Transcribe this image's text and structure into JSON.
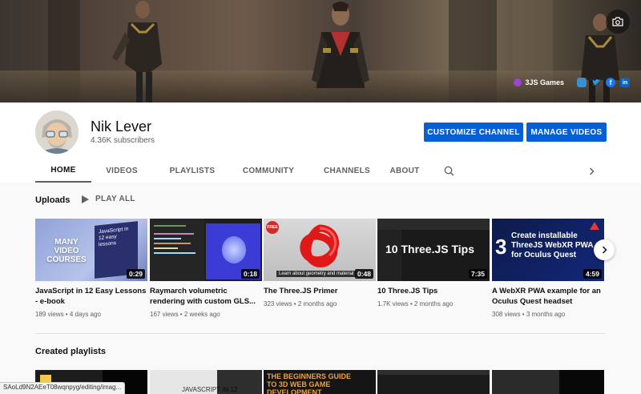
{
  "banner": {
    "link_label": "3JS Games",
    "social_icons": [
      "community-icon",
      "twitter-icon",
      "facebook-icon",
      "linkedin-icon"
    ]
  },
  "channel": {
    "name": "Nik Lever",
    "subscribers": "4.36K subscribers"
  },
  "buttons": {
    "customize": "CUSTOMIZE CHANNEL",
    "manage": "MANAGE VIDEOS"
  },
  "tabs": [
    "HOME",
    "VIDEOS",
    "PLAYLISTS",
    "COMMUNITY",
    "CHANNELS",
    "ABOUT"
  ],
  "uploads": {
    "title": "Uploads",
    "play_all": "PLAY ALL",
    "videos": [
      {
        "title": "JavaScript in 12 Easy Lessons - e-book",
        "views": "189 views",
        "age": "4 days ago",
        "duration": "0:29",
        "thumb_text": "MANY VIDEO COURSES",
        "thumb_book": "JavaScript in 12 easy lessons"
      },
      {
        "title": "Raymarch volumetric rendering with custom GLS...",
        "views": "167 views",
        "age": "2 weeks ago",
        "duration": "0:18"
      },
      {
        "title": "The Three.JS Primer",
        "views": "323 views",
        "age": "2 months ago",
        "duration": "0:48",
        "thumb_badge": "FREE",
        "thumb_caption": "Learn about geometry and material"
      },
      {
        "title": "10 Three.JS Tips",
        "views": "1.7K views",
        "age": "2 months ago",
        "duration": "7:35",
        "thumb_text": "10 Three.JS Tips"
      },
      {
        "title": "A WebXR PWA example for an Oculus Quest headset",
        "views": "308 views",
        "age": "3 months ago",
        "duration": "4:59",
        "thumb_num": "3",
        "thumb_text": "Create installable ThreeJS WebXR PWA for Oculus Quest"
      }
    ]
  },
  "playlists": {
    "title": "Created playlists",
    "thumb_texts": [
      "",
      "JAVASCRIPT IN 12",
      "THE BEGINNERS GUIDE TO 3D WEB GAME DEVELOPMENT",
      "",
      ""
    ]
  },
  "status_url": "SAoLd9N2AEeT08wqnpyg/editing/imag..."
}
